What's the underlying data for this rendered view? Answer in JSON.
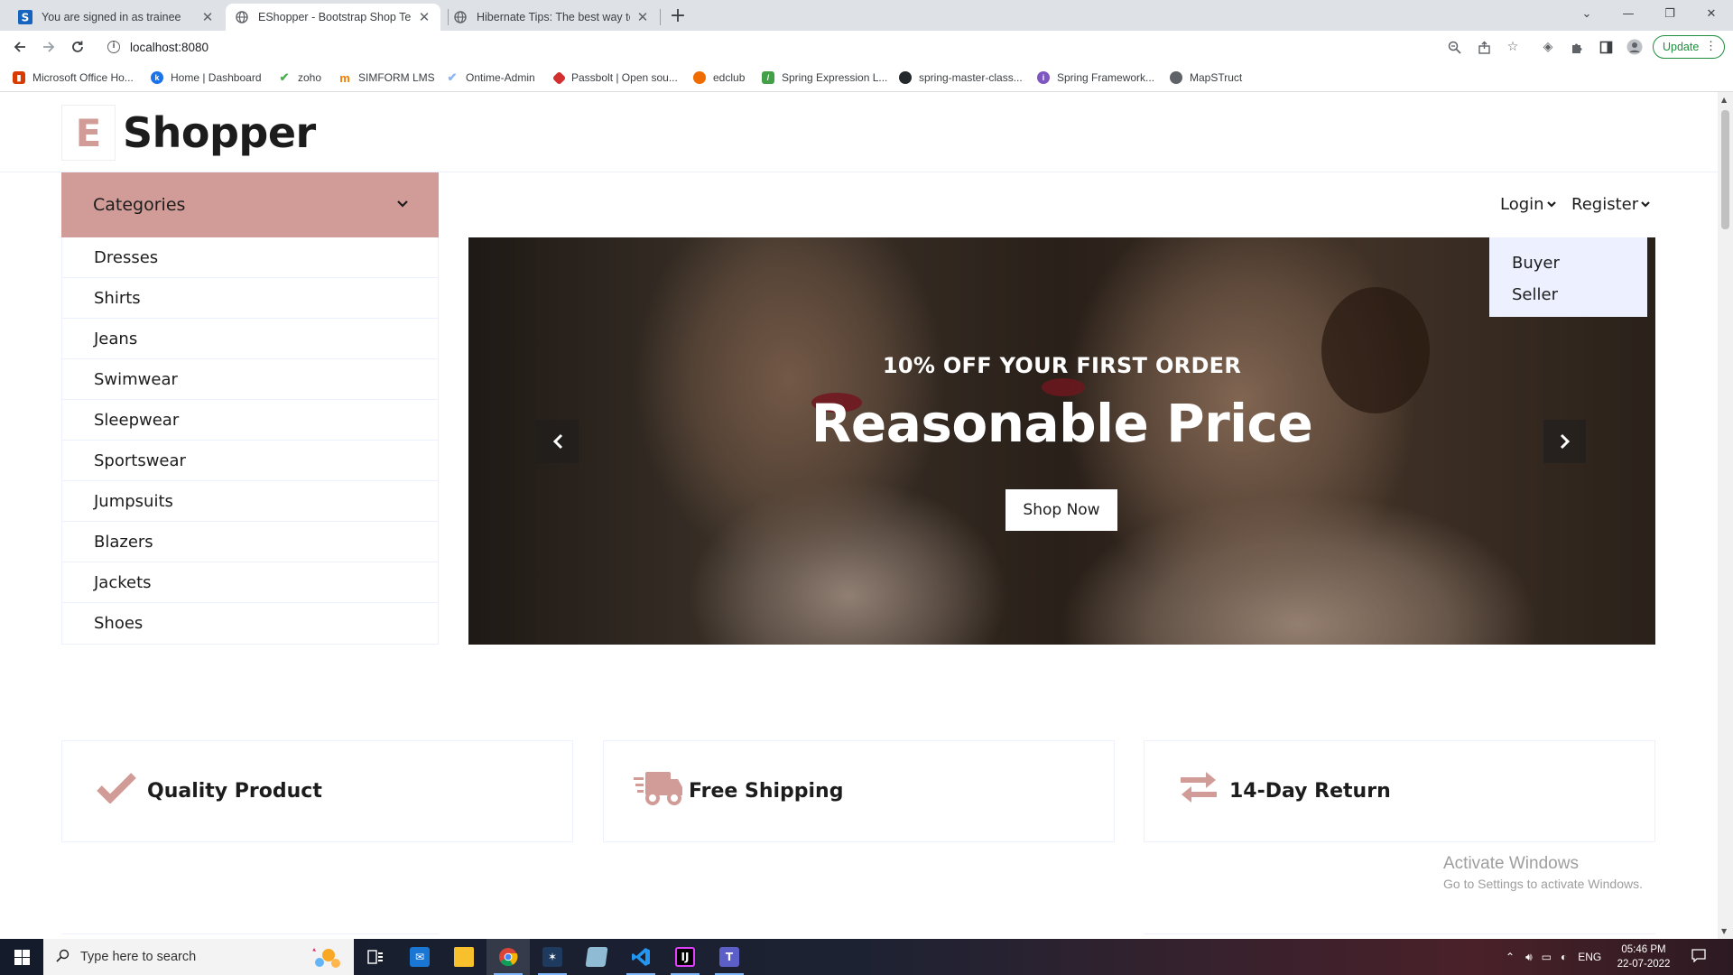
{
  "browser": {
    "tabs": [
      {
        "title": "You are signed in as trainee",
        "active": false,
        "icon": "simform-s-icon"
      },
      {
        "title": "EShopper - Bootstrap Shop Temp",
        "active": true,
        "icon": "globe-icon"
      },
      {
        "title": "Hibernate Tips: The best way to r",
        "active": false,
        "icon": "globe-icon"
      }
    ],
    "url": "localhost:8080",
    "update_label": "Update",
    "bookmarks": [
      {
        "label": "Microsoft Office Ho...",
        "icon": "office-icon",
        "color": "#d83b01"
      },
      {
        "label": "Home | Dashboard",
        "icon": "k-icon",
        "color": "#1a73e8"
      },
      {
        "label": "zoho",
        "icon": "check-icon",
        "color": "#4caf50"
      },
      {
        "label": "SIMFORM LMS",
        "icon": "lms-icon",
        "color": "#f57c00"
      },
      {
        "label": "Ontime-Admin",
        "icon": "check-icon",
        "color": "#8ab4f8"
      },
      {
        "label": "Passbolt | Open sou...",
        "icon": "passbolt-icon",
        "color": "#d32f2f"
      },
      {
        "label": "edclub",
        "icon": "edclub-icon",
        "color": "#ef6c00"
      },
      {
        "label": "Spring Expression L...",
        "icon": "spring-icon",
        "color": "#43a047"
      },
      {
        "label": "spring-master-class...",
        "icon": "github-icon",
        "color": "#24292e"
      },
      {
        "label": "Spring Framework...",
        "icon": "spring-framework-icon",
        "color": "#7e57c2"
      },
      {
        "label": "MapSTruct",
        "icon": "globe-icon",
        "color": "#5f6368"
      }
    ]
  },
  "site": {
    "logo_letter": "E",
    "logo_word": "Shopper",
    "accent_color": "#d19c97",
    "categories_label": "Categories",
    "categories": [
      "Dresses",
      "Shirts",
      "Jeans",
      "Swimwear",
      "Sleepwear",
      "Sportswear",
      "Jumpsuits",
      "Blazers",
      "Jackets",
      "Shoes"
    ],
    "nav": {
      "login": "Login",
      "register": "Register",
      "register_menu": [
        "Buyer",
        "Seller"
      ]
    },
    "hero": {
      "subtitle": "10% OFF YOUR FIRST ORDER",
      "title": "Reasonable Price",
      "button": "Shop Now"
    },
    "features": [
      {
        "label": "Quality Product",
        "icon": "check-icon"
      },
      {
        "label": "Free Shipping",
        "icon": "truck-icon"
      },
      {
        "label": "14-Day Return",
        "icon": "exchange-icon"
      }
    ]
  },
  "watermark": {
    "line1": "Activate Windows",
    "line2": "Go to Settings to activate Windows."
  },
  "taskbar": {
    "search_placeholder": "Type here to search",
    "language": "ENG",
    "time": "05:46 PM",
    "date": "22-07-2022"
  }
}
